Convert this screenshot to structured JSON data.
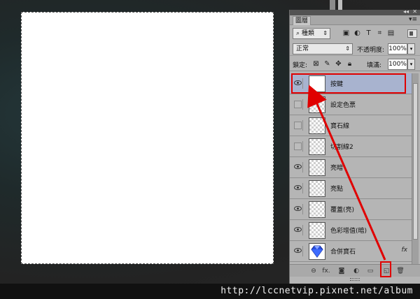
{
  "panel": {
    "tab_label": "圖層",
    "filter": {
      "label": "種類"
    },
    "blend_mode": "正常",
    "opacity_label": "不透明度:",
    "opacity_value": "100%",
    "lock_label": "鎖定:",
    "fill_label": "填滿:",
    "fill_value": "100%"
  },
  "layers": [
    {
      "name": "按鍵",
      "visible": true,
      "selected": true,
      "thumb": "white"
    },
    {
      "name": "設定色票",
      "visible": false,
      "selected": false,
      "thumb": "transparent"
    },
    {
      "name": "寶石線",
      "visible": false,
      "selected": false,
      "thumb": "transparent"
    },
    {
      "name": "切割線2",
      "visible": false,
      "selected": false,
      "thumb": "transparent"
    },
    {
      "name": "亮暗",
      "visible": true,
      "selected": false,
      "thumb": "transparent"
    },
    {
      "name": "亮點",
      "visible": true,
      "selected": false,
      "thumb": "transparent"
    },
    {
      "name": "覆蓋(亮)",
      "visible": true,
      "selected": false,
      "thumb": "transparent"
    },
    {
      "name": "色彩增值(暗)",
      "visible": true,
      "selected": false,
      "thumb": "transparent"
    },
    {
      "name": "合併寶石",
      "visible": true,
      "selected": false,
      "thumb": "gem",
      "fx": "fx"
    }
  ],
  "bottom_toolbar": {
    "fx_label": "fx."
  },
  "footer": {
    "url": "http://lccnetvip.pixnet.net/album"
  },
  "colors": {
    "highlight": "#e00000",
    "selected_layer": "#a8b3cf"
  }
}
